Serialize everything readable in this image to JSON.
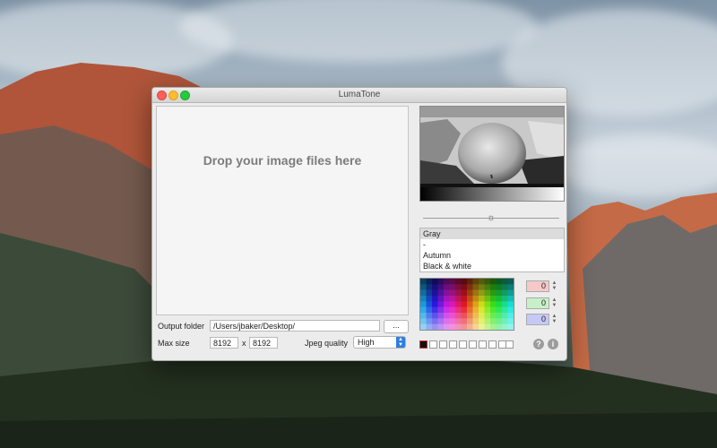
{
  "window": {
    "title": "LumaTone"
  },
  "dropzone": {
    "message": "Drop your image files here"
  },
  "output": {
    "label": "Output folder",
    "path": "/Users/jbaker/Desktop/",
    "browse_label": "..."
  },
  "max_size": {
    "label": "Max size",
    "width": "8192",
    "separator": "x",
    "height": "8192"
  },
  "jpeg": {
    "label": "Jpeg quality",
    "value": "High"
  },
  "palettes": {
    "items": [
      {
        "label": "Gray",
        "selected": true
      },
      {
        "label": "-",
        "selected": false
      },
      {
        "label": "Autumn",
        "selected": false
      },
      {
        "label": "Black & white",
        "selected": false
      }
    ]
  },
  "color_spinners": [
    {
      "value": "0",
      "color": "#f6c8c8"
    },
    {
      "value": "0",
      "color": "#c8f0c8"
    },
    {
      "value": "0",
      "color": "#c8c8f6"
    }
  ],
  "icons": {
    "brightness": "sun-icon",
    "help": "question-icon",
    "info": "info-icon",
    "stepper": "up-down-chevron-icon"
  },
  "help_glyph": "?",
  "info_glyph": "i",
  "brightness_glyph": "☼",
  "stepper_glyph": "▲▼"
}
